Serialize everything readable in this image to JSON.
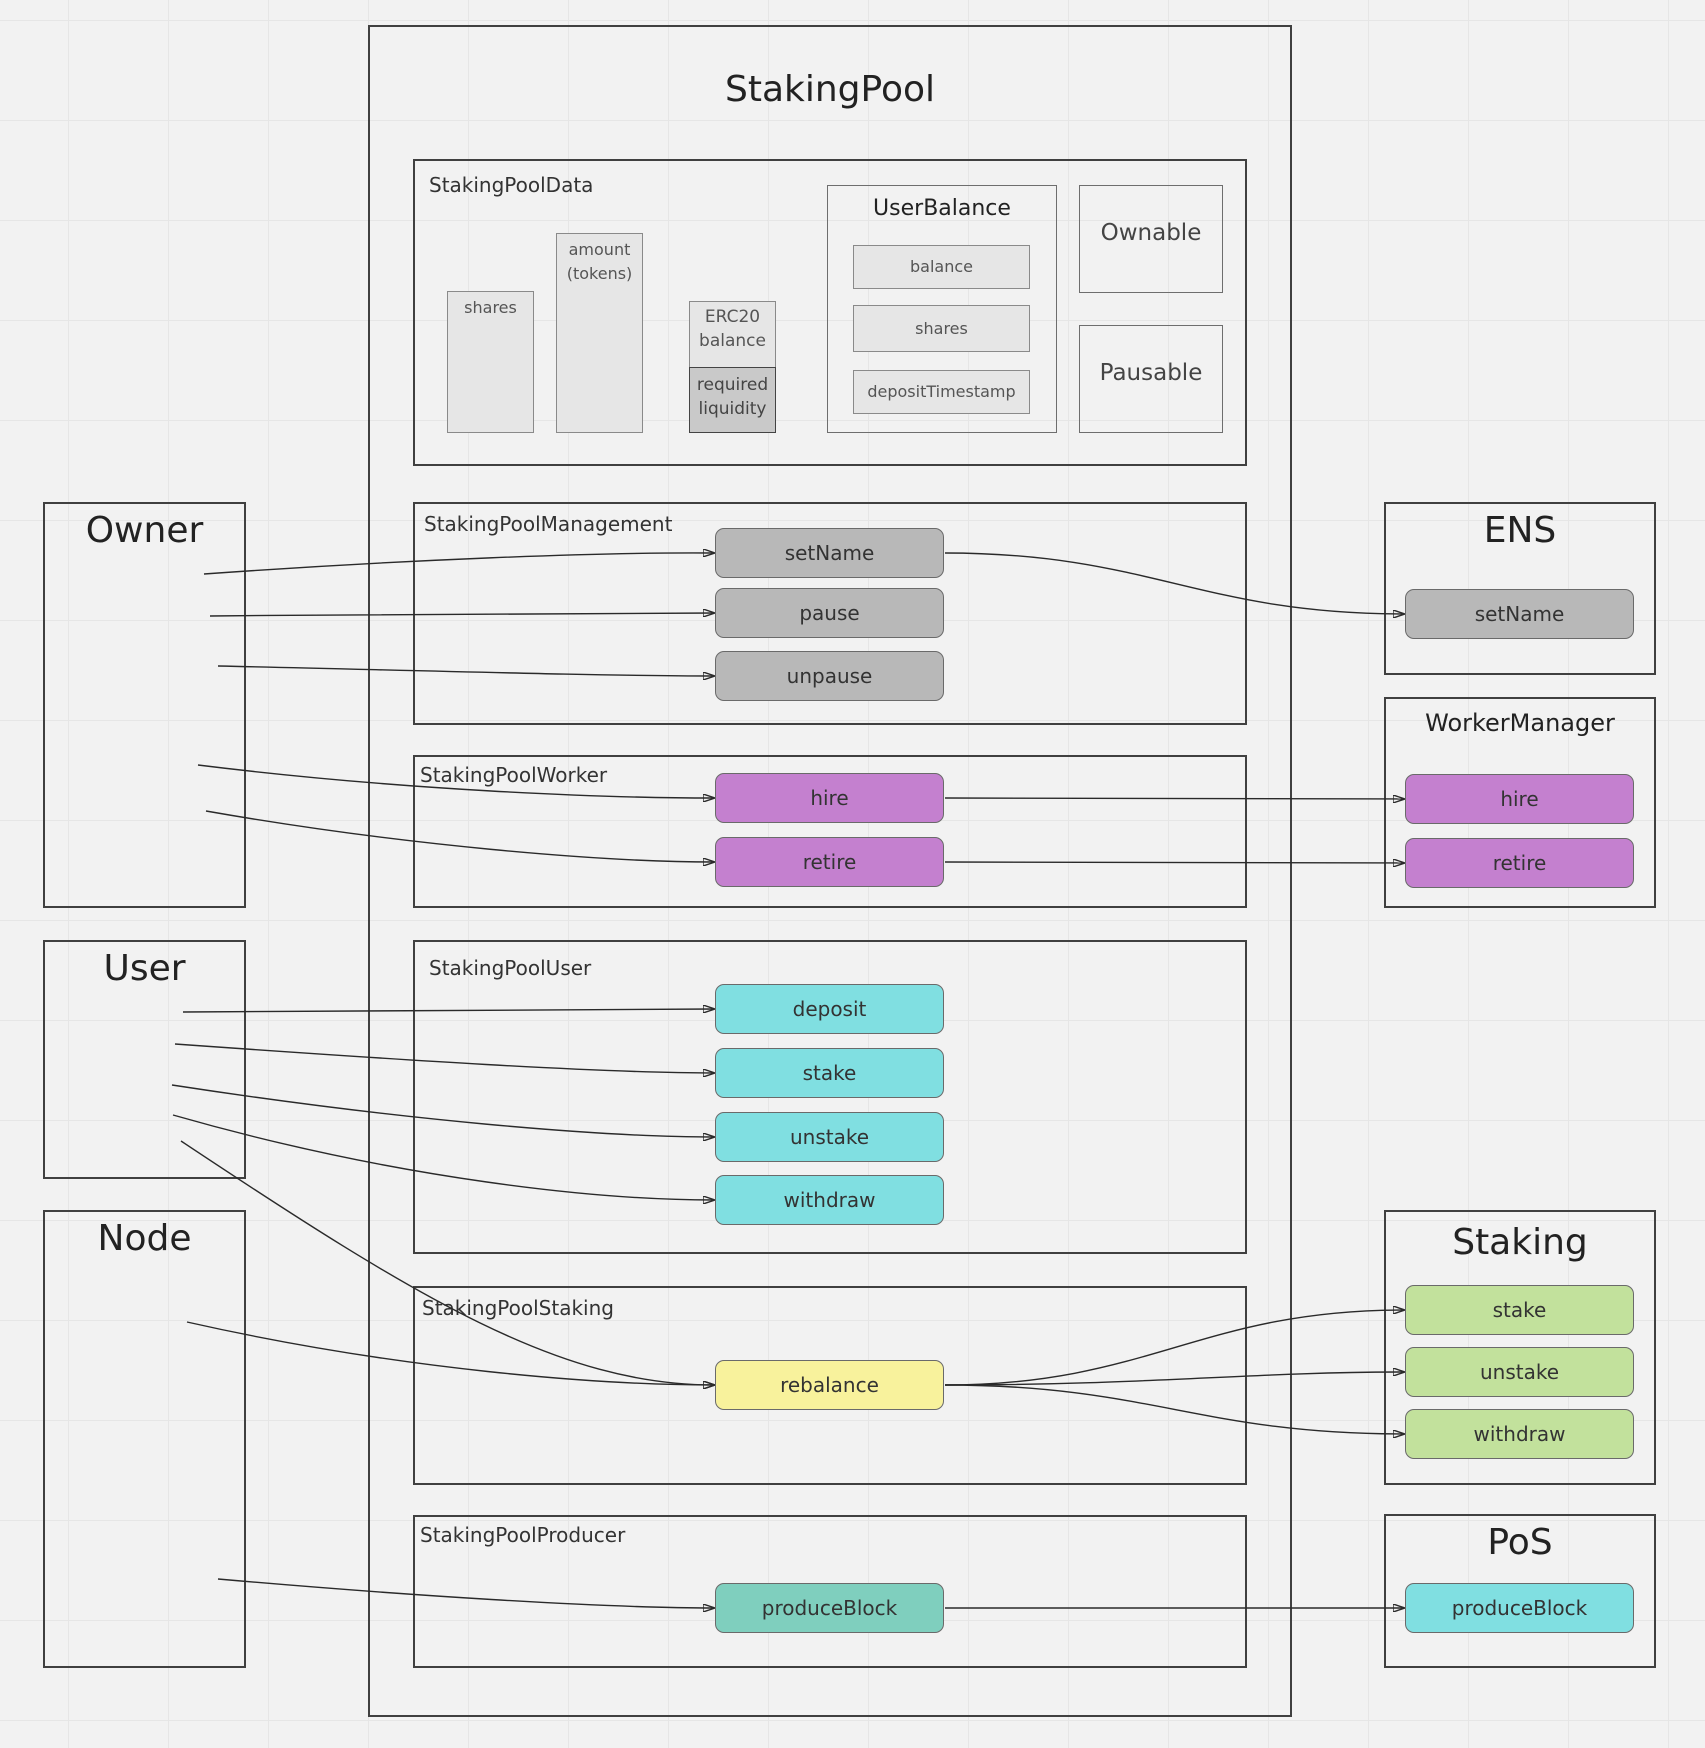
{
  "diagram": {
    "main_title": "StakingPool",
    "data_section": {
      "title": "StakingPoolData",
      "shares": "shares",
      "amount": "amount\n(tokens)",
      "erc20_balance": "ERC20\nbalance",
      "required_liquidity": "required\nliquidity",
      "user_balance": {
        "title": "UserBalance",
        "fields": [
          "balance",
          "shares",
          "depositTimestamp"
        ]
      },
      "ownable": "Ownable",
      "pausable": "Pausable"
    },
    "management": {
      "title": "StakingPoolManagement",
      "functions": [
        "setName",
        "pause",
        "unpause"
      ]
    },
    "worker": {
      "title": "StakingPoolWorker",
      "functions": [
        "hire",
        "retire"
      ]
    },
    "user_section": {
      "title": "StakingPoolUser",
      "functions": [
        "deposit",
        "stake",
        "unstake",
        "withdraw"
      ]
    },
    "staking_section": {
      "title": "StakingPoolStaking",
      "functions": [
        "rebalance"
      ]
    },
    "producer": {
      "title": "StakingPoolProducer",
      "functions": [
        "produceBlock"
      ]
    },
    "actors": {
      "owner": "Owner",
      "user": "User",
      "node": "Node"
    },
    "external": {
      "ens": {
        "title": "ENS",
        "functions": [
          "setName"
        ]
      },
      "worker_manager": {
        "title": "WorkerManager",
        "functions": [
          "hire",
          "retire"
        ]
      },
      "staking": {
        "title": "Staking",
        "functions": [
          "stake",
          "unstake",
          "withdraw"
        ]
      },
      "pos": {
        "title": "PoS",
        "functions": [
          "produceBlock"
        ]
      }
    },
    "colors": {
      "management": "#b8b8b8",
      "worker": "#c480cf",
      "user": "#80dfe1",
      "staking": "#f8f29c",
      "external_staking": "#c2e19c",
      "producer": "#7fcfbe",
      "pos": "#80dfe1"
    },
    "connections": [
      {
        "from": "Owner",
        "to": "StakingPoolManagement.setName"
      },
      {
        "from": "Owner",
        "to": "StakingPoolManagement.pause"
      },
      {
        "from": "Owner",
        "to": "StakingPoolManagement.unpause"
      },
      {
        "from": "Owner",
        "to": "StakingPoolWorker.hire"
      },
      {
        "from": "Owner",
        "to": "StakingPoolWorker.retire"
      },
      {
        "from": "User",
        "to": "StakingPoolUser.deposit"
      },
      {
        "from": "User",
        "to": "StakingPoolUser.stake"
      },
      {
        "from": "User",
        "to": "StakingPoolUser.unstake"
      },
      {
        "from": "User",
        "to": "StakingPoolUser.withdraw"
      },
      {
        "from": "User",
        "to": "StakingPoolStaking.rebalance"
      },
      {
        "from": "Node",
        "to": "StakingPoolStaking.rebalance"
      },
      {
        "from": "Node",
        "to": "StakingPoolProducer.produceBlock"
      },
      {
        "from": "StakingPoolManagement.setName",
        "to": "ENS.setName"
      },
      {
        "from": "StakingPoolWorker.hire",
        "to": "WorkerManager.hire"
      },
      {
        "from": "StakingPoolWorker.retire",
        "to": "WorkerManager.retire"
      },
      {
        "from": "StakingPoolStaking.rebalance",
        "to": "Staking.stake"
      },
      {
        "from": "StakingPoolStaking.rebalance",
        "to": "Staking.unstake"
      },
      {
        "from": "StakingPoolStaking.rebalance",
        "to": "Staking.withdraw"
      },
      {
        "from": "StakingPoolProducer.produceBlock",
        "to": "PoS.produceBlock"
      }
    ]
  }
}
